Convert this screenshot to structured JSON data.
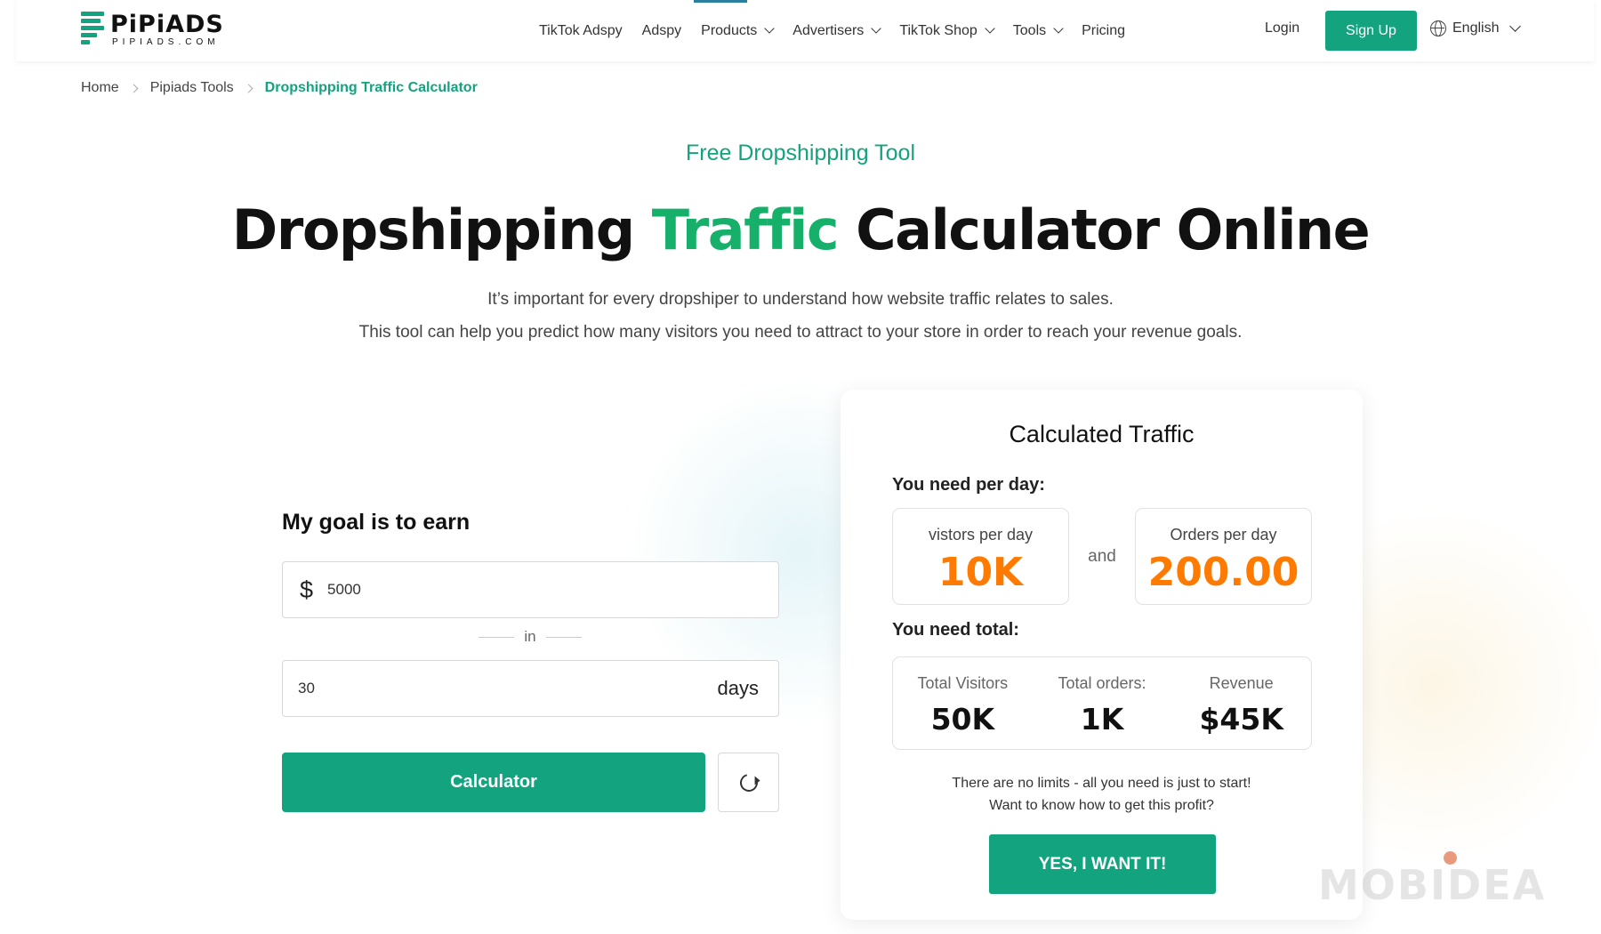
{
  "brand": {
    "name": "PiPiADS",
    "domain": "PIPIADS.COM",
    "accent": "#14a37f",
    "highlight": "#16b06b",
    "value_color": "#ff7a00"
  },
  "nav": {
    "items": [
      {
        "label": "TikTok Adspy",
        "dropdown": false
      },
      {
        "label": "Adspy",
        "dropdown": false
      },
      {
        "label": "Products",
        "dropdown": true
      },
      {
        "label": "Advertisers",
        "dropdown": true
      },
      {
        "label": "TikTok Shop",
        "dropdown": true
      },
      {
        "label": "Tools",
        "dropdown": true
      },
      {
        "label": "Pricing",
        "dropdown": false
      }
    ],
    "login": "Login",
    "signup": "Sign Up",
    "language": "English"
  },
  "breadcrumb": {
    "home": "Home",
    "tools": "Pipiads Tools",
    "current": "Dropshipping Traffic Calculator"
  },
  "hero": {
    "tagline": "Free Dropshipping Tool",
    "title_part1": "Dropshipping ",
    "title_accent": "Traffic",
    "title_part2": " Calculator Online",
    "subtitle_line1": "It’s important for every dropshiper to understand how website traffic relates to sales.",
    "subtitle_line2": "This tool can help you predict how many visitors you need to attract to your store in order to reach your revenue goals."
  },
  "form": {
    "goal_label": "My goal is to earn",
    "currency_symbol": "$",
    "amount_value": "5000",
    "in_label": "in",
    "days_value": "30",
    "days_unit": "days",
    "calculate_label": "Calculator"
  },
  "result": {
    "title": "Calculated Traffic",
    "per_day_label": "You need per day:",
    "visitors_label": "vistors per day",
    "visitors_value": "10K",
    "and_label": "and",
    "orders_label": "Orders per day",
    "orders_value": "200.00",
    "total_label": "You need total:",
    "totals": [
      {
        "label": "Total Visitors",
        "value": "50K"
      },
      {
        "label": "Total orders:",
        "value": "1K"
      },
      {
        "label": "Revenue",
        "value": "$45K"
      }
    ],
    "promo_line1": "There are no limits - all you need is just to start!",
    "promo_line2": "Want to know how to get this profit?",
    "cta_label": "YES, I WANT IT!"
  },
  "watermark": "MOBIDEA"
}
